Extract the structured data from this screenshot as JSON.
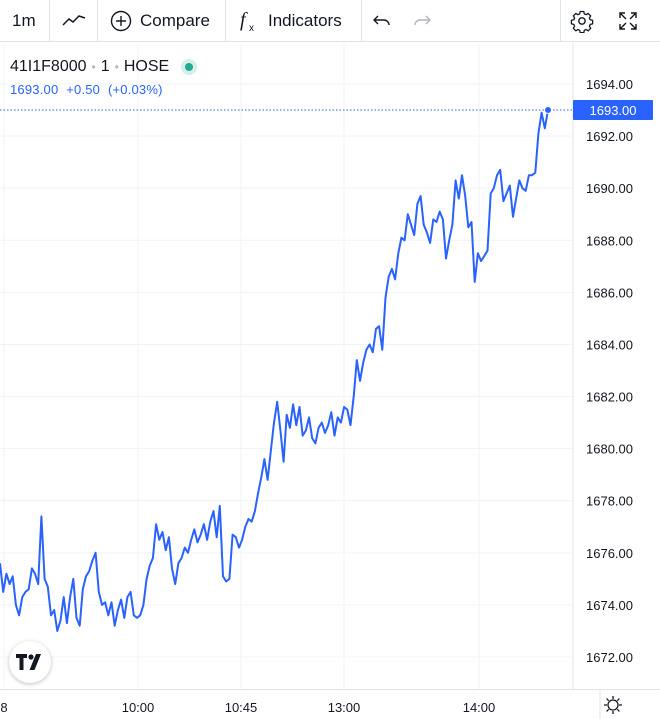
{
  "toolbar": {
    "interval": "1m",
    "compare_label": "Compare",
    "indicators_label": "Indicators"
  },
  "legend": {
    "symbol": "41I1F8000",
    "interval": "1",
    "exchange": "HOSE",
    "last": "1693.00",
    "change": "+0.50",
    "change_pct": "(+0.03%)"
  },
  "price_label": "1693.00",
  "colors": {
    "line": "#2962ff",
    "status": "#22ab94",
    "grid": "#f0f3fa",
    "text": "#131722"
  },
  "chart_data": {
    "type": "line",
    "y_ticks": [
      "1694.00",
      "1692.00",
      "1690.00",
      "1688.00",
      "1686.00",
      "1684.00",
      "1682.00",
      "1680.00",
      "1678.00",
      "1676.00",
      "1674.00",
      "1672.00"
    ],
    "x_ticks": [
      "8",
      "10:00",
      "10:45",
      "13:00",
      "14:00"
    ],
    "ylim": [
      1671,
      1695
    ],
    "last_value": 1693.0,
    "series": [
      {
        "values": [
          1675.6,
          1674.5,
          1675.2,
          1674.8,
          1675.1,
          1674.0,
          1673.6,
          1674.3,
          1674.5,
          1674.6,
          1675.4,
          1675.2,
          1674.8,
          1677.4,
          1675.0,
          1674.7,
          1673.6,
          1673.8,
          1673.0,
          1673.4,
          1674.3,
          1673.3,
          1674.3,
          1675.0,
          1673.5,
          1673.2,
          1674.6,
          1675.1,
          1675.3,
          1675.7,
          1676.0,
          1674.5,
          1674.0,
          1674.1,
          1673.6,
          1674.1,
          1673.2,
          1673.8,
          1674.2,
          1673.5,
          1674.3,
          1674.5,
          1673.6,
          1673.5,
          1673.6,
          1674.0,
          1675.0,
          1675.5,
          1675.8,
          1677.1,
          1676.5,
          1676.8,
          1676.1,
          1676.6,
          1675.4,
          1674.8,
          1675.6,
          1675.8,
          1676.2,
          1676.0,
          1676.5,
          1676.9,
          1676.4,
          1676.7,
          1677.1,
          1676.5,
          1677.2,
          1677.6,
          1676.6,
          1677.8,
          1675.1,
          1674.9,
          1675.0,
          1676.7,
          1676.6,
          1676.2,
          1676.5,
          1677.0,
          1677.3,
          1677.2,
          1677.6,
          1678.3,
          1678.9,
          1679.6,
          1678.8,
          1679.9,
          1681.0,
          1681.8,
          1680.7,
          1679.5,
          1681.3,
          1680.8,
          1681.7,
          1680.9,
          1681.6,
          1680.5,
          1680.7,
          1681.2,
          1680.4,
          1680.2,
          1680.8,
          1681.0,
          1680.6,
          1680.9,
          1681.4,
          1680.5,
          1681.2,
          1681.0,
          1681.6,
          1681.5,
          1680.9,
          1682.0,
          1683.4,
          1682.6,
          1683.3,
          1683.8,
          1684.0,
          1683.7,
          1684.6,
          1684.7,
          1683.8,
          1685.8,
          1686.6,
          1686.9,
          1686.5,
          1687.5,
          1688.1,
          1688.0,
          1689.0,
          1688.6,
          1688.2,
          1689.4,
          1689.7,
          1688.6,
          1688.3,
          1687.9,
          1688.8,
          1688.7,
          1689.1,
          1688.8,
          1687.3,
          1688.0,
          1688.6,
          1690.3,
          1689.6,
          1690.5,
          1689.7,
          1688.5,
          1688.7,
          1686.4,
          1687.5,
          1687.2,
          1687.4,
          1687.6,
          1689.8,
          1690.0,
          1690.5,
          1690.7,
          1689.5,
          1689.8,
          1690.1,
          1688.9,
          1689.6,
          1690.3,
          1690.0,
          1689.9,
          1690.5,
          1690.5,
          1690.6,
          1692.1,
          1692.9,
          1692.3,
          1693.0
        ]
      }
    ]
  }
}
